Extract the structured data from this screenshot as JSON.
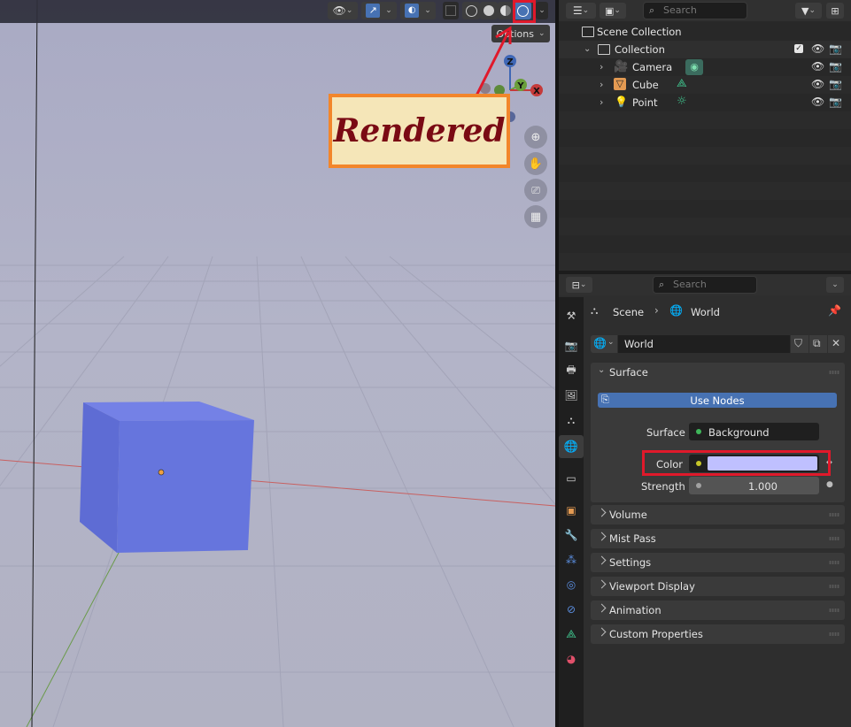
{
  "viewport": {
    "options_label": "Options",
    "annotation_label": "Rendered",
    "gizmo": {
      "z": "Z",
      "y": "Y",
      "x": "X"
    }
  },
  "outliner": {
    "search_placeholder": "Search",
    "scene_collection": "Scene Collection",
    "collection": "Collection",
    "items": [
      {
        "label": "Camera"
      },
      {
        "label": "Cube"
      },
      {
        "label": "Point"
      }
    ]
  },
  "properties": {
    "search_placeholder": "Search",
    "breadcrumb": {
      "scene": "Scene",
      "world": "World"
    },
    "world_name": "World",
    "surface_panel": {
      "title": "Surface",
      "use_nodes": "Use Nodes",
      "surface_label": "Surface",
      "surface_value": "Background",
      "color_label": "Color",
      "color_value": "#bfc0ff",
      "strength_label": "Strength",
      "strength_value": "1.000"
    },
    "panels": [
      "Volume",
      "Mist Pass",
      "Settings",
      "Viewport Display",
      "Animation",
      "Custom Properties"
    ]
  },
  "colors": {
    "accent_blue": "#4772b3",
    "highlight_red": "#e0192b",
    "annotation_border": "#f2862b",
    "annotation_fill": "#f5e6b8",
    "annotation_text": "#7a0a14",
    "cube": "#6675dd"
  }
}
